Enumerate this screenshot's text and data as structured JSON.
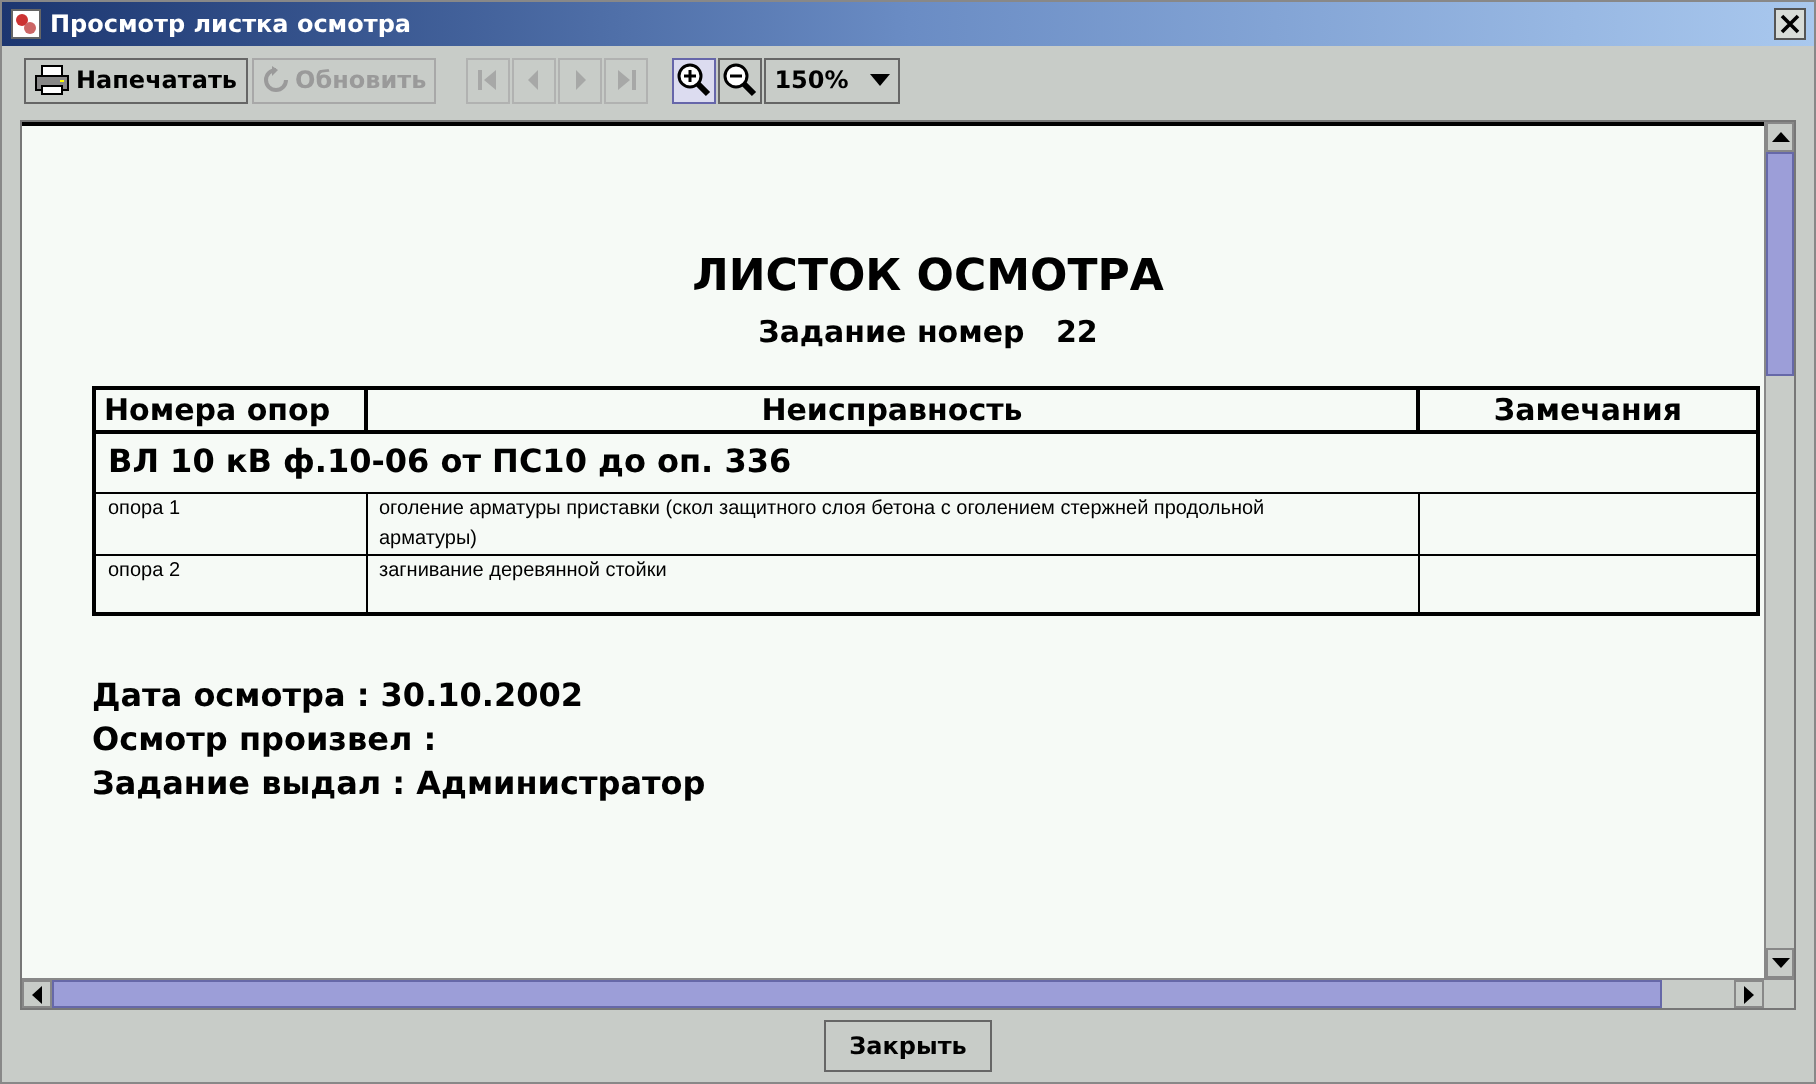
{
  "window": {
    "title": "Просмотр листка осмотра"
  },
  "toolbar": {
    "actions": [
      {
        "kind": "print",
        "label": "Напечатать",
        "disabled": false
      },
      {
        "kind": "refresh",
        "label": "Обновить",
        "disabled": true
      }
    ],
    "navigation": [
      {
        "kind": "first",
        "disabled": true
      },
      {
        "kind": "prev",
        "disabled": true
      },
      {
        "kind": "next",
        "disabled": true
      },
      {
        "kind": "last",
        "disabled": true
      }
    ],
    "zoom": [
      {
        "kind": "zoom-in",
        "selected": true
      },
      {
        "kind": "zoom-out",
        "selected": false
      }
    ],
    "zoom_select": {
      "value": "150%"
    }
  },
  "document": {
    "title": "ЛИСТОК ОСМОТРА",
    "subtitle_label": "Задание номер",
    "subtitle_number": "22",
    "table": {
      "columns": [
        "Номера опор",
        "Неисправность",
        "Замечания"
      ],
      "section": "ВЛ 10 кВ ф.10-06 от ПС10 до оп. 336",
      "rows": [
        {
          "cells": [
            "опора 1",
            "оголение арматуры приставки (скол защитного слоя бетона с оголением стержней продольной арматуры)",
            ""
          ]
        },
        {
          "cells": [
            "опора 2",
            "загнивание деревянной стойки",
            ""
          ]
        }
      ]
    },
    "footer": [
      "Дата осмотра : 30.10.2002",
      "Осмотр произвел :",
      "Задание выдал : Администратор"
    ]
  },
  "buttons": [
    "Закрыть"
  ]
}
